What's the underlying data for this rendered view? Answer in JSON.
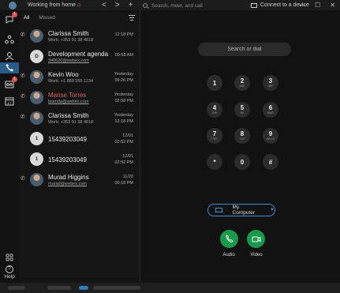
{
  "titlebar": {
    "status": "Working from home",
    "nav_back": "<",
    "nav_forward": ">",
    "nav_add": "+",
    "search_placeholder": "Search, meet, and call",
    "device": "Connect to a device",
    "win_min": "—",
    "win_max": "☐",
    "win_close": "✕"
  },
  "rail": {
    "badge_messages": "1",
    "badge_calls": "1",
    "help": "Help"
  },
  "tabs": {
    "all": "All",
    "missed": "Missed"
  },
  "calls": [
    {
      "name": "Clarissa Smith",
      "sub": "Work: +353 91 38 4618",
      "time1": "12:18 PM",
      "time2": "",
      "avatar": "photo",
      "initial": "",
      "missed": false
    },
    {
      "name": "Development agenda",
      "sub": "340620@webex.com",
      "time1": "09:58 AM",
      "time2": "",
      "avatar": "initial",
      "initial": "D",
      "missed": false
    },
    {
      "name": "Kevin Woo",
      "sub": "Work: +1 888 555 1234",
      "time1": "Yesterday",
      "time2": "09:26 PM",
      "avatar": "photo",
      "initial": "",
      "missed": false
    },
    {
      "name": "Marise Torres",
      "sub": "bsenda@webex.com",
      "time1": "Yesterday",
      "time2": "02:58 PM",
      "avatar": "photo",
      "initial": "",
      "missed": true
    },
    {
      "name": "Clarissa Smith",
      "sub": "Work: +353 91 38 4618",
      "time1": "Yesterday",
      "time2": "12:18 PM",
      "avatar": "photo",
      "initial": "",
      "missed": false
    },
    {
      "name": "15439203049",
      "sub": "",
      "time1": "12/01",
      "time2": "02:52 PM",
      "avatar": "initial",
      "initial": "1",
      "missed": false
    },
    {
      "name": "15439203049",
      "sub": "",
      "time1": "12/01",
      "time2": "02:52 PM",
      "avatar": "initial",
      "initial": "1",
      "missed": false
    },
    {
      "name": "Murad Higgins",
      "sub": "murad@webex.com",
      "time1": "11/20",
      "time2": "09:18 PM",
      "avatar": "photo",
      "initial": "",
      "missed": false
    }
  ],
  "dialer": {
    "placeholder": "Search or dial",
    "keys": [
      {
        "digit": "1",
        "letters": ""
      },
      {
        "digit": "2",
        "letters": "ABC"
      },
      {
        "digit": "3",
        "letters": "DEF"
      },
      {
        "digit": "4",
        "letters": "GHI"
      },
      {
        "digit": "5",
        "letters": "JKL"
      },
      {
        "digit": "6",
        "letters": "MNO"
      },
      {
        "digit": "7",
        "letters": "PRS"
      },
      {
        "digit": "8",
        "letters": "TUV"
      },
      {
        "digit": "9",
        "letters": "WXYZ"
      },
      {
        "digit": "*",
        "letters": ""
      },
      {
        "digit": "0",
        "letters": ""
      },
      {
        "digit": "#",
        "letters": ""
      }
    ],
    "device_select": "My Computer",
    "audio_label": "Audio",
    "video_label": "Video"
  },
  "colors": {
    "accent": "#2b5c87",
    "call_green": "#199a4a",
    "missed_red": "#e06262",
    "device_blue": "#3f8fd6"
  }
}
